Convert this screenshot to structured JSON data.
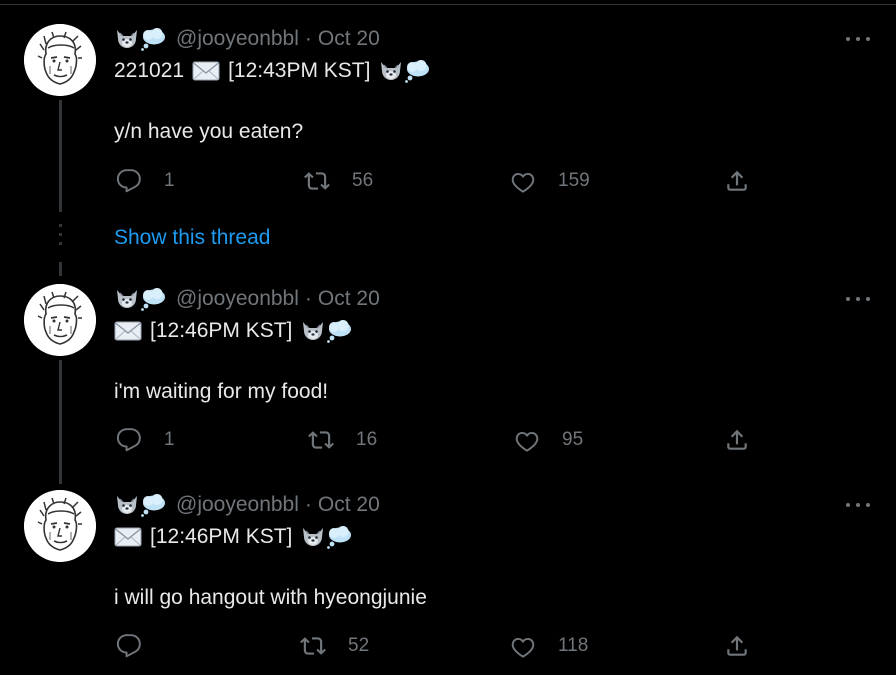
{
  "colors": {
    "background": "#000000",
    "text_primary": "#e7e9ea",
    "text_secondary": "#71767b",
    "link": "#1d9bf0",
    "thread_line": "#333639"
  },
  "icons": {
    "emoji_pair": [
      "wolf-emoji",
      "thought-balloon-emoji"
    ],
    "envelope": "envelope-emoji",
    "more": "more-icon",
    "reply": "reply-icon",
    "retweet": "retweet-icon",
    "like": "heart-icon",
    "share": "share-icon"
  },
  "show_thread": "Show this thread",
  "tweets": [
    {
      "handle": "@jooyeonbbl",
      "separator": "·",
      "date": "Oct 20",
      "line1_prefix": "221021",
      "line1_time": "[12:43PM KST]",
      "body": "y/n have you eaten?",
      "replies": "1",
      "retweets": "56",
      "likes": "159"
    },
    {
      "handle": "@jooyeonbbl",
      "separator": "·",
      "date": "Oct 20",
      "line1_prefix": "",
      "line1_time": "[12:46PM KST]",
      "body": "i'm waiting for my food!",
      "replies": "1",
      "retweets": "16",
      "likes": "95"
    },
    {
      "handle": "@jooyeonbbl",
      "separator": "·",
      "date": "Oct 20",
      "line1_prefix": "",
      "line1_time": "[12:46PM KST]",
      "body": "i will go hangout with hyeongjunie",
      "replies": "",
      "retweets": "52",
      "likes": "118"
    }
  ]
}
